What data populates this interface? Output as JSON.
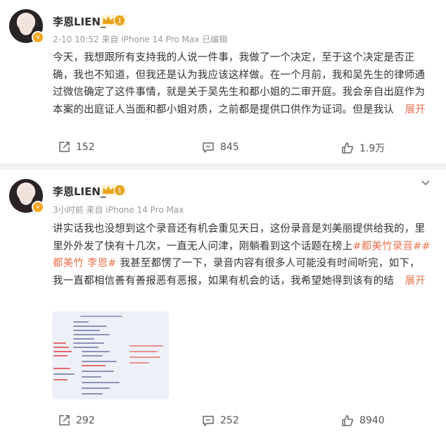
{
  "posts": [
    {
      "author": "李恩LIEN_",
      "crown_level": "1",
      "meta": "2-10 10:52  来自 iPhone 14 Pro Max  已编辑",
      "lines": [
        "今天，我想跟所有支持我的人说一件事，我做了一个决定，至于这个决定是否正",
        "确，我也不知道，但我还是认为我应该这样做。在一个月前，我和吴先生的律师通",
        "过微信确定了这件事情，就是关于吴先生和都小姐的二审开庭。我会亲自出庭作为",
        "本案的出庭证人当面和都小姐对质，之前都是提供口供作为证词。但是我认"
      ],
      "expand_label": "展开",
      "repost_count": "152",
      "comment_count": "845",
      "like_count": "1.9万"
    },
    {
      "author": "李恩LIEN_",
      "crown_level": "1",
      "meta": "3小时前  来自 iPhone 14 Pro Max",
      "line1": "讲实话我也没想到这个录音还有机会重见天日，这份录音是刘美丽提供给我的，里",
      "line2": "里外外发了快有十几次，一直无人问津，刚躺看到这个话题在榜上",
      "tag1": "#都美竹录音##",
      "tag2": "都美竹 李恩#",
      "line3": " 我甚至都愣了一下，录音内容有很多人可能没有时间听完，如下，",
      "line4": "我一直都相信善有善报恶有恶报，如果有机会的话，我希望她得到该有的结",
      "expand_label": "展开",
      "repost_count": "292",
      "comment_count": "252",
      "like_count": "8940"
    }
  ],
  "colors": {
    "accent": "#eb7350",
    "meta": "#999999",
    "crown": "#e8a21a"
  },
  "icons": [
    "verified-badge-icon",
    "crown-icon",
    "chevron-down-icon",
    "repost-icon",
    "comment-icon",
    "like-icon"
  ]
}
